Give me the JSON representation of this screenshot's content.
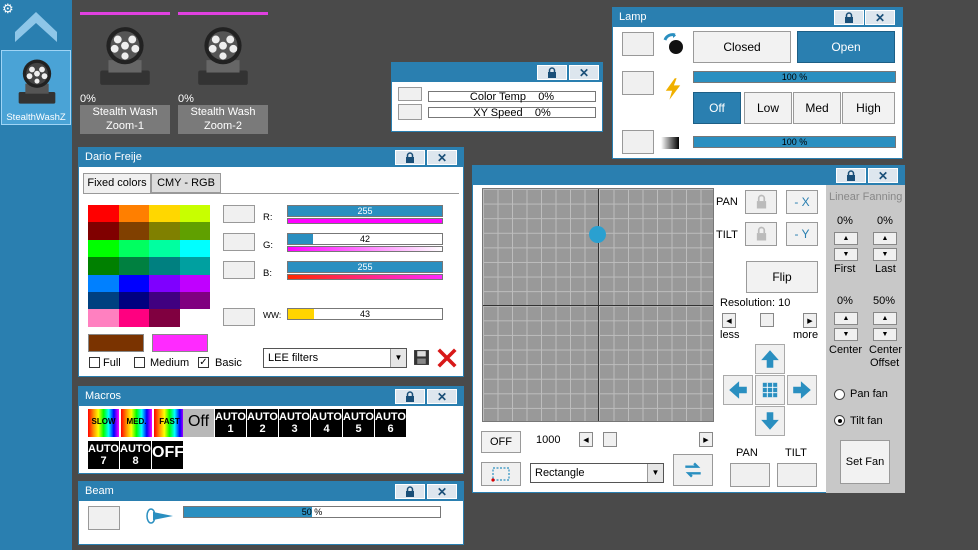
{
  "sidebar": {
    "fixture_label": "StealthWashZ"
  },
  "fixtures": [
    {
      "percent": "0%",
      "name_line1": "Stealth Wash",
      "name_line2": "Zoom-1"
    },
    {
      "percent": "0%",
      "name_line1": "Stealth Wash",
      "name_line2": "Zoom-2"
    }
  ],
  "speed_window": {
    "rows": [
      {
        "label": "Color Temp",
        "value": "0%"
      },
      {
        "label": "XY Speed",
        "value": "0%"
      }
    ]
  },
  "lamp": {
    "title": "Lamp",
    "closed": "Closed",
    "open": "Open",
    "intensity_bar": "100 %",
    "off": "Off",
    "low": "Low",
    "med": "Med",
    "high": "High",
    "dimmer_bar": "100 %"
  },
  "color_window": {
    "title": "Dario Freije",
    "tab_fixed": "Fixed colors",
    "tab_cmy": "CMY - RGB",
    "r_label": "R:",
    "g_label": "G:",
    "b_label": "B:",
    "ww_label": "WW:",
    "r_value": "255",
    "g_value": "42",
    "b_value": "255",
    "ww_value": "43",
    "r_level": 1.0,
    "g_level": 0.165,
    "b_level": 1.0,
    "ww_level": 0.17,
    "full": "Full",
    "medium": "Medium",
    "basic": "Basic",
    "filter_select": "LEE filters",
    "swatches": [
      "#ff0000",
      "#ff7f00",
      "#ffd700",
      "#c8ff00",
      "#800000",
      "#804000",
      "#808000",
      "#60a000",
      "#00ff00",
      "#00ff60",
      "#00ffa0",
      "#00ffff",
      "#008000",
      "#008040",
      "#008080",
      "#00a0a0",
      "#0080ff",
      "#0000ff",
      "#7f00ff",
      "#c000ff",
      "#004080",
      "#000080",
      "#400080",
      "#800080",
      "#ff80c0",
      "#ff0080",
      "#800040",
      "#ffffff"
    ],
    "preview_left": "#7a3300",
    "preview_right": "#ff2aff"
  },
  "macros": {
    "title": "Macros",
    "items": [
      "SLOW",
      "MED.",
      "FAST",
      "Off",
      "AUTO 1",
      "AUTO 2",
      "AUTO 3",
      "AUTO 4",
      "AUTO 5",
      "AUTO 6",
      "AUTO 7",
      "AUTO 8",
      "OFF"
    ]
  },
  "beam": {
    "title": "Beam",
    "bar": "50 %"
  },
  "position": {
    "pan": "PAN",
    "tilt": "TILT",
    "minus_x": "- X",
    "minus_y": "- Y",
    "flip": "Flip",
    "resolution": "Resolution: 10",
    "less": "less",
    "more": "more",
    "off_btn": "OFF",
    "speed_val": "1000",
    "shape_select": "Rectangle",
    "pan_btn": "PAN",
    "tilt_btn": "TILT",
    "fanning_title": "Linear Fanning",
    "first_pct": "0%",
    "last_pct": "0%",
    "first": "First",
    "last": "Last",
    "center_pct": "0%",
    "center_offset_pct": "50%",
    "center": "Center",
    "center_offset1": "Center",
    "center_offset2": "Offset",
    "pan_fan": "Pan fan",
    "tilt_fan": "Tilt fan",
    "set_fan": "Set Fan"
  }
}
